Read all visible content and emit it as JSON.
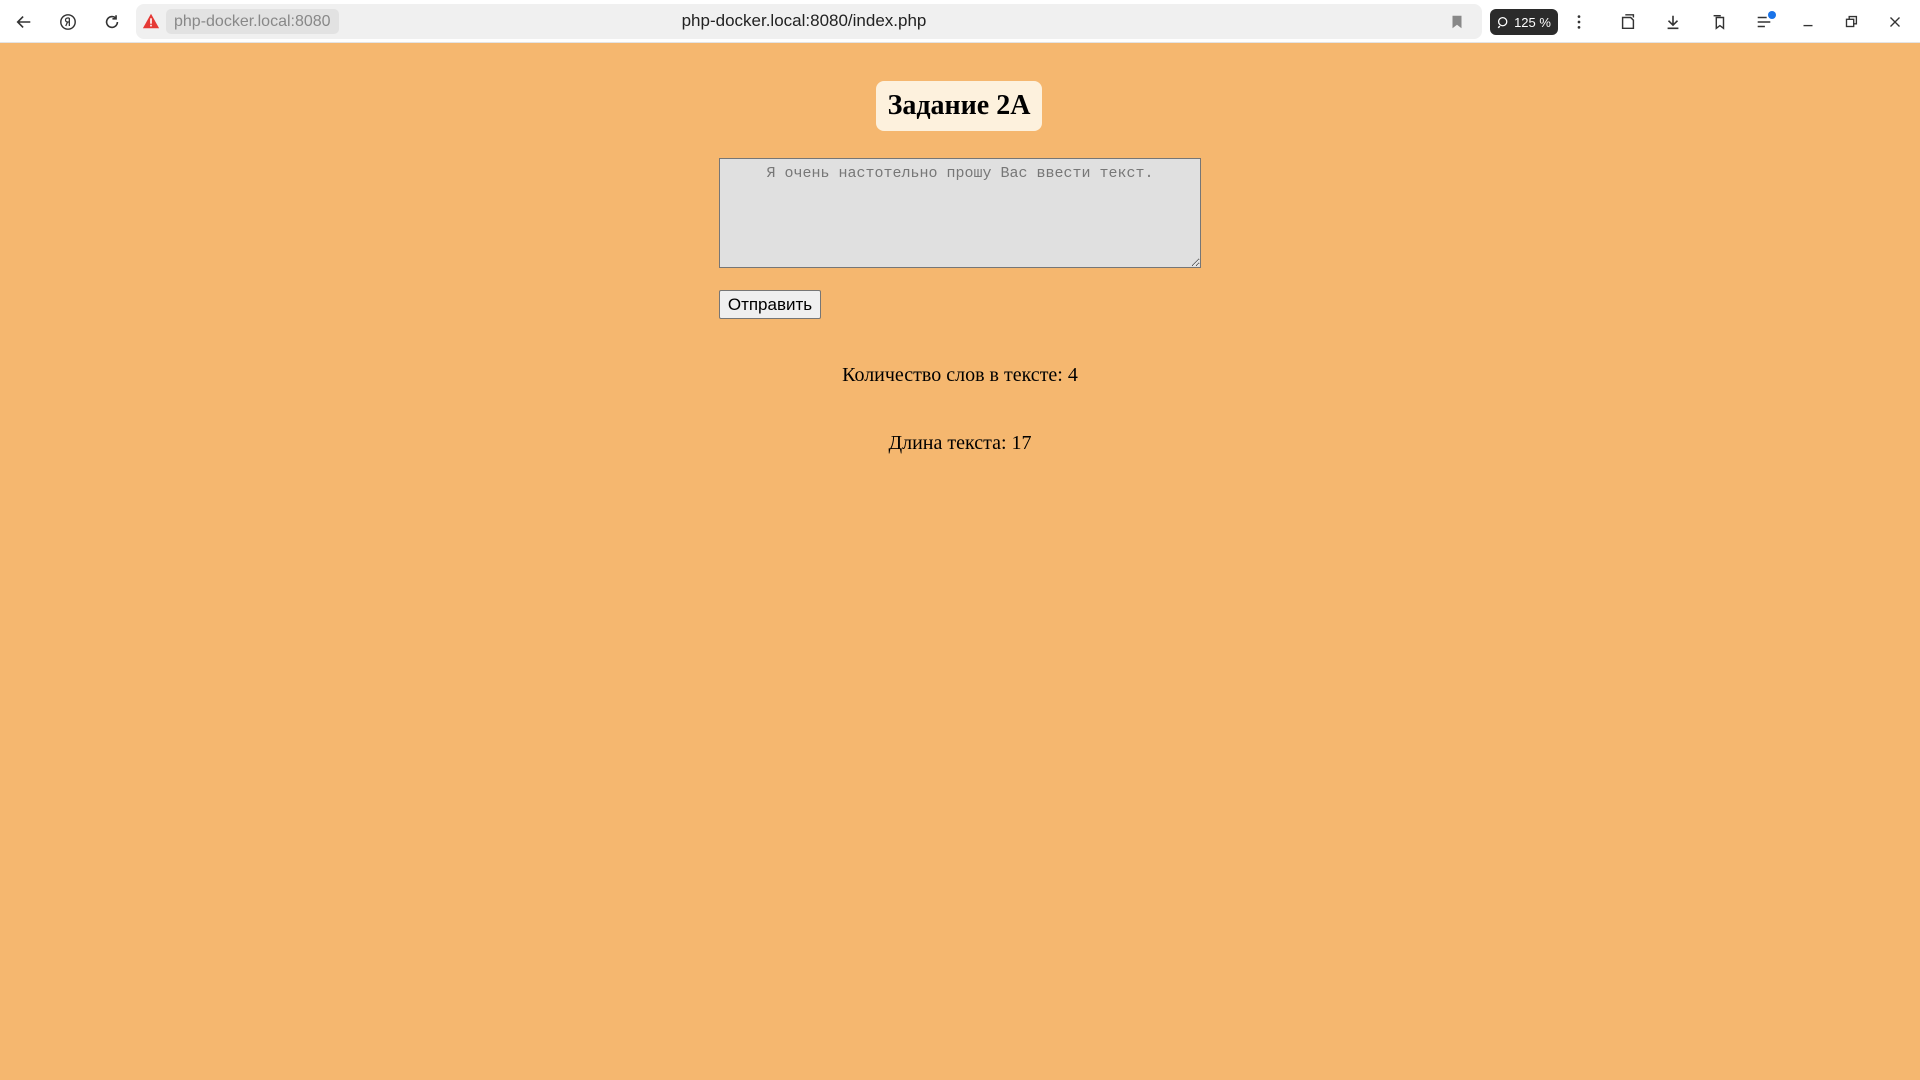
{
  "browser": {
    "address_domain": "php-docker.local:8080",
    "url": "php-docker.local:8080/index.php",
    "zoom": "125 %"
  },
  "page": {
    "title": "Задание 2А",
    "textarea_placeholder": "Я очень настотельно прошу Вас ввести текст.",
    "textarea_value": "",
    "submit_label": "Отправить",
    "word_count_label": "Количество слов в тексте:",
    "word_count": "4",
    "length_label": "Длина текста:",
    "length": "17"
  },
  "colors": {
    "background": "#f5b76f",
    "title_bg": "#fdf1dd",
    "textarea_bg": "#e0e0e0"
  }
}
